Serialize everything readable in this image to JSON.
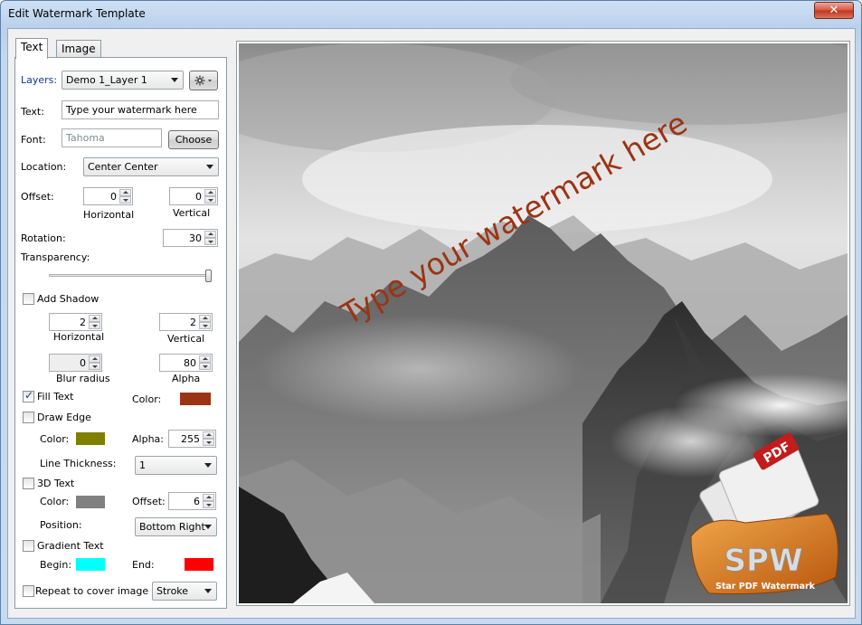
{
  "window": {
    "title": "Edit Watermark Template",
    "close_glyph": "✕"
  },
  "tabs": [
    {
      "label": "Text",
      "active": true
    },
    {
      "label": "Image",
      "active": false
    }
  ],
  "form": {
    "layers_label": "Layers:",
    "layers_value": "Demo 1_Layer 1",
    "gear_icon": "gear-icon",
    "text_label": "Text:",
    "text_value": "Type your watermark here",
    "font_label": "Font:",
    "font_value": "Tahoma",
    "choose_button": "Choose",
    "location_label": "Location:",
    "location_value": "Center Center",
    "offset_label": "Offset:",
    "offset_horizontal": "0",
    "offset_vertical": "0",
    "horizontal_caption": "Horizontal",
    "vertical_caption": "Vertical",
    "rotation_label": "Rotation:",
    "rotation_value": "30",
    "transparency_label": "Transparency:",
    "transparency_level": 1.0,
    "add_shadow_label": "Add Shadow",
    "add_shadow_checked": false,
    "shadow_horizontal": "2",
    "shadow_vertical": "2",
    "shadow_horizontal_caption": "Horizontal",
    "shadow_vertical_caption": "Vertical",
    "blur_radius_value": "0",
    "blur_radius_caption": "Blur radius",
    "alpha_value": "80",
    "alpha_caption": "Alpha",
    "fill_text_label": "Fill Text",
    "fill_text_checked": true,
    "fill_color_label": "Color:",
    "fill_color": "#9b3414",
    "draw_edge_label": "Draw Edge",
    "draw_edge_checked": false,
    "edge_color_label": "Color:",
    "edge_color": "#7f7f00",
    "edge_alpha_label": "Alpha:",
    "edge_alpha_value": "255",
    "line_thickness_label": "Line Thickness:",
    "line_thickness_value": "1",
    "three_d_label": "3D Text",
    "three_d_checked": false,
    "three_d_color_label": "Color:",
    "three_d_color": "#808080",
    "three_d_offset_label": "Offset:",
    "three_d_offset_value": "6",
    "position_label": "Position:",
    "position_value": "Bottom Right",
    "gradient_label": "Gradient Text",
    "gradient_checked": false,
    "begin_label": "Begin:",
    "begin_color": "#00ffff",
    "end_label": "End:",
    "end_color": "#ff0000",
    "repeat_label": "Repeat to cover image",
    "repeat_checked": false,
    "stroke_value": "Stroke"
  },
  "preview": {
    "watermark_text": "Type your watermark here",
    "watermark_color": "#9b3414",
    "logo_text": "SPW",
    "logo_caption": "Star PDF Watermark",
    "logo_badge": "PDF"
  }
}
